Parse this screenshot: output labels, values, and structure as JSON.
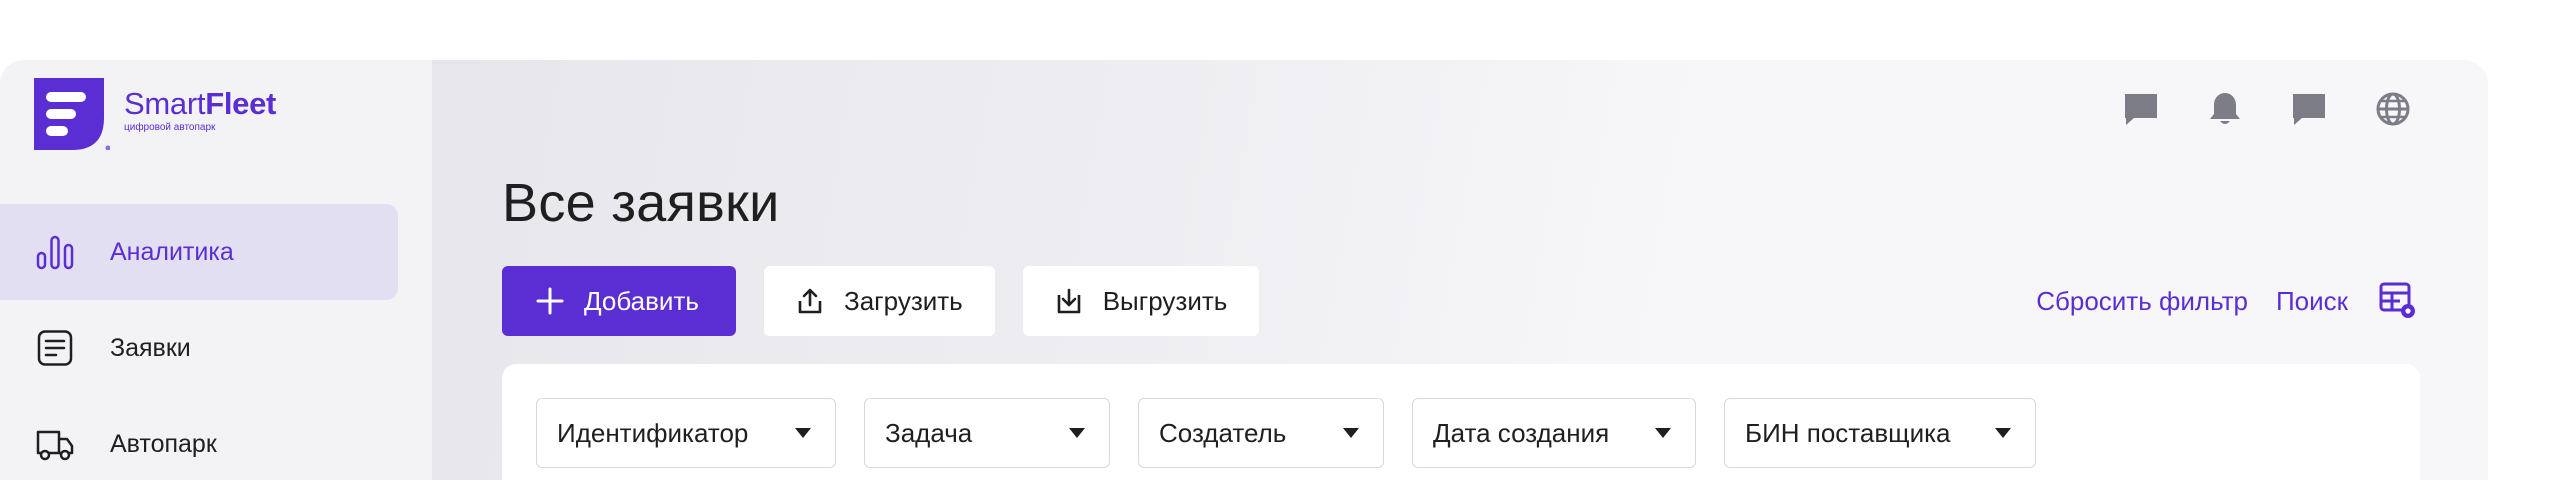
{
  "brand": {
    "name_light": "Smart",
    "name_bold": "Fleet",
    "tagline": "цифровой автопарк",
    "accent_color": "#5a2ed3"
  },
  "sidebar": {
    "items": [
      {
        "label": "Аналитика",
        "icon": "bar-chart-icon",
        "active": true
      },
      {
        "label": "Заявки",
        "icon": "document-icon",
        "active": false
      },
      {
        "label": "Автопарк",
        "icon": "truck-icon",
        "active": false
      }
    ]
  },
  "header": {
    "icons": [
      "chat-icon",
      "bell-icon",
      "message-icon",
      "globe-icon"
    ]
  },
  "page": {
    "title": "Все заявки"
  },
  "toolbar": {
    "add_label": "Добавить",
    "upload_label": "Загрузить",
    "download_label": "Выгрузить",
    "reset_filter_label": "Сбросить фильтр",
    "search_label": "Поиск"
  },
  "filters": [
    {
      "label": "Идентификатор"
    },
    {
      "label": "Задача"
    },
    {
      "label": "Создатель"
    },
    {
      "label": "Дата создания"
    },
    {
      "label": "БИН поставщика"
    }
  ]
}
